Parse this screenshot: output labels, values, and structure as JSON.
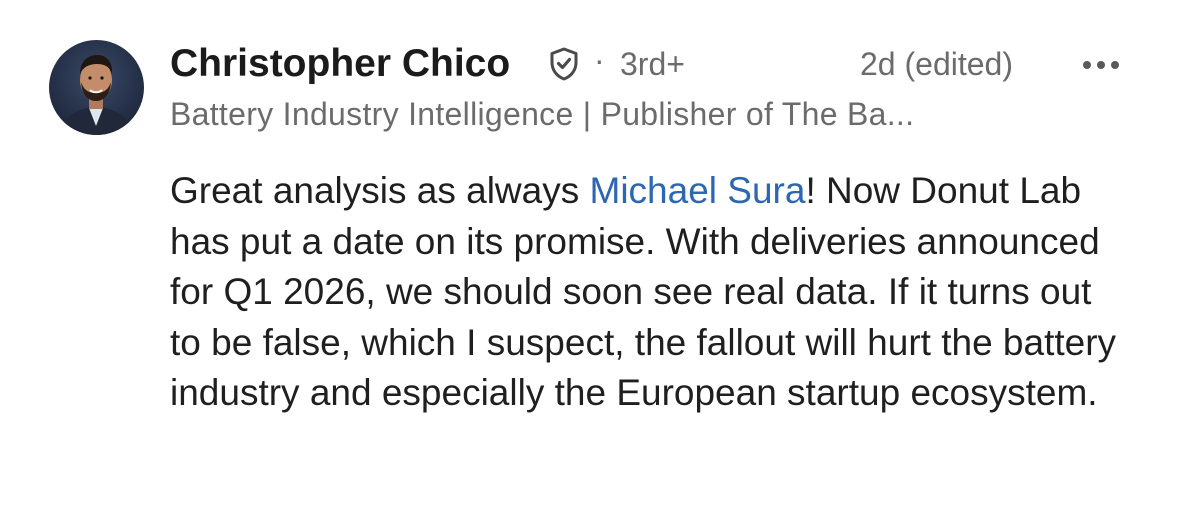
{
  "comment": {
    "author": {
      "name": "Christopher Chico",
      "verified_icon": "shield-check-icon",
      "degree": "3rd+",
      "headline": "Battery Industry Intelligence | Publisher of The Ba..."
    },
    "separator": "·",
    "timestamp": "2d (edited)",
    "more_icon": "more-horizontal-icon",
    "body": {
      "before_mention": "Great analysis as always ",
      "mention": "Michael Sura",
      "after_mention": "! Now Donut Lab has put a date on its promise. With deliveries announced for Q1 2026, we should soon see real data. If it turns out to be false, which I suspect, the fallout will hurt the battery industry and especially the European startup ecosystem."
    }
  },
  "colors": {
    "text_primary": "#1f1f1f",
    "text_secondary": "#6b6b6b",
    "mention": "#2e67b1"
  }
}
